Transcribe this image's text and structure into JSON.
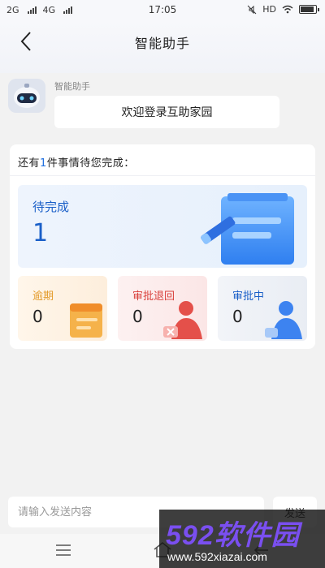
{
  "status_bar": {
    "network_1": "2G",
    "network_2": "4G",
    "time": "17:05",
    "hd": "HD"
  },
  "nav": {
    "title": "智能助手"
  },
  "chat": {
    "sender_name": "智能助手",
    "welcome_message": "欢迎登录互助家园"
  },
  "tasks": {
    "header_prefix": "还有",
    "header_count": "1",
    "header_suffix": "件事情待您完成：",
    "pending": {
      "label": "待完成",
      "count": "1"
    },
    "overdue": {
      "label": "逾期",
      "count": "0",
      "color": "#e39a28"
    },
    "rejected": {
      "label": "审批退回",
      "count": "0",
      "color": "#d9413c"
    },
    "in_review": {
      "label": "审批中",
      "count": "0",
      "color": "#1a5fc8"
    }
  },
  "input": {
    "placeholder": "请输入发送内容",
    "send_label": "发送"
  },
  "watermark": {
    "logo": "592软件园",
    "url": "www.592xiazai.com"
  },
  "icons": {
    "back": "chevron-left-icon",
    "mute": "mute-icon",
    "wifi": "wifi-icon",
    "battery": "battery-icon",
    "menu": "menu-icon",
    "home": "home-icon",
    "back_nav": "back-nav-icon"
  }
}
